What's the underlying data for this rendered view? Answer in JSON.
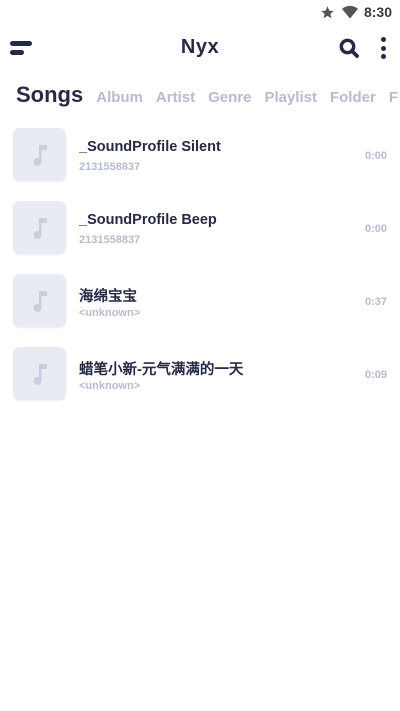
{
  "status_bar": {
    "time": "8:30",
    "icons": [
      "star-icon",
      "wifi-icon"
    ]
  },
  "app_bar": {
    "title": "Nyx",
    "icons": [
      "menu-icon",
      "search-icon",
      "more-vertical-icon"
    ]
  },
  "tabs": [
    {
      "label": "Songs",
      "active": true
    },
    {
      "label": "Album",
      "active": false
    },
    {
      "label": "Artist",
      "active": false
    },
    {
      "label": "Genre",
      "active": false
    },
    {
      "label": "Playlist",
      "active": false
    },
    {
      "label": "Folder",
      "active": false
    },
    {
      "label": "F",
      "active": false
    }
  ],
  "songs": [
    {
      "title": "_SoundProfile Silent",
      "artist": "2131558837",
      "duration": "0:00",
      "art_icon": "music-note-icon"
    },
    {
      "title": "_SoundProfile Beep",
      "artist": "2131558837",
      "duration": "0:00",
      "art_icon": "music-note-icon"
    },
    {
      "title": "海绵宝宝",
      "artist": "<unknown>",
      "duration": "0:37",
      "art_icon": "music-note-icon"
    },
    {
      "title": "蜡笔小新-元气满满的一天",
      "artist": "<unknown>",
      "duration": "0:09",
      "art_icon": "music-note-icon"
    }
  ],
  "colors": {
    "primary_text": "#262a44",
    "secondary_text": "#b7bccd",
    "art_background": "#e9ebf3",
    "note_icon": "#c9cede"
  }
}
